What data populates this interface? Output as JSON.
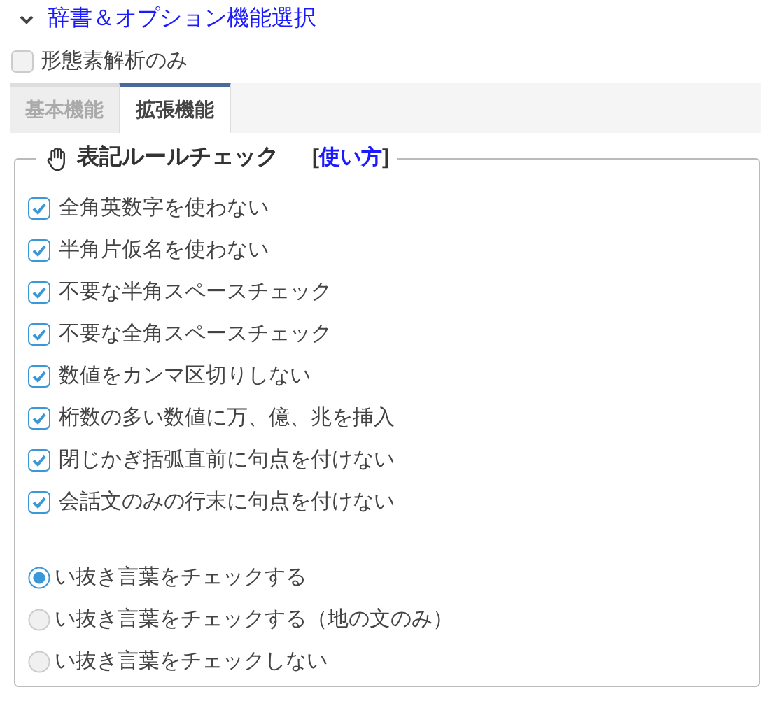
{
  "section": {
    "title": "辞書＆オプション機能選択",
    "expanded": true
  },
  "morph_only": {
    "label": "形態素解析のみ",
    "checked": false
  },
  "tabs": [
    {
      "label": "基本機能",
      "selected": false
    },
    {
      "label": "拡張機能",
      "selected": true
    }
  ],
  "group": {
    "title": "表記ルールチェック",
    "help_open": "[",
    "help_link": "使い方",
    "help_close": "]",
    "checks": [
      {
        "label": "全角英数字を使わない",
        "checked": true
      },
      {
        "label": "半角片仮名を使わない",
        "checked": true
      },
      {
        "label": "不要な半角スペースチェック",
        "checked": true
      },
      {
        "label": "不要な全角スペースチェック",
        "checked": true
      },
      {
        "label": "数値をカンマ区切りしない",
        "checked": true
      },
      {
        "label": "桁数の多い数値に万、億、兆を挿入",
        "checked": true
      },
      {
        "label": "閉じかぎ括弧直前に句点を付けない",
        "checked": true
      },
      {
        "label": "会話文のみの行末に句点を付けない",
        "checked": true
      }
    ],
    "radios": [
      {
        "label": "い抜き言葉をチェックする",
        "selected": true
      },
      {
        "label": "い抜き言葉をチェックする（地の文のみ）",
        "selected": false
      },
      {
        "label": "い抜き言葉をチェックしない",
        "selected": false
      }
    ]
  }
}
